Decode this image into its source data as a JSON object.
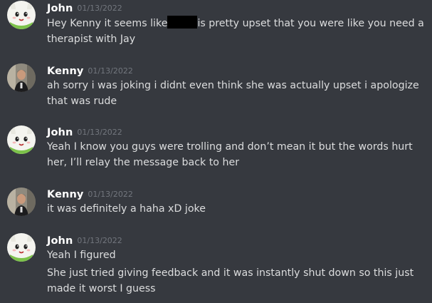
{
  "messages": [
    {
      "author": "John",
      "timestamp": "01/13/2022",
      "avatar_icon": "cat-mascot-avatar",
      "lines": [
        {
          "before": "Hey Kenny it seems like",
          "after": "is pretty upset that you were like you need a"
        },
        "therapist with Jay"
      ]
    },
    {
      "author": "Kenny",
      "timestamp": "01/13/2022",
      "avatar_icon": "person-photo-avatar",
      "lines": [
        "ah sorry i was joking i didnt even think she was actually upset i apologize",
        "that was rude"
      ]
    },
    {
      "author": "John",
      "timestamp": "01/13/2022",
      "avatar_icon": "cat-mascot-avatar",
      "lines": [
        "Yeah I know you guys were trolling and don’t mean it but the words hurt",
        "her, I’ll relay the message back to her"
      ]
    },
    {
      "author": "Kenny",
      "timestamp": "01/13/2022",
      "avatar_icon": "person-photo-avatar",
      "lines": [
        "it was definitely a haha xD joke"
      ]
    },
    {
      "author": "John",
      "timestamp": "01/13/2022",
      "avatar_icon": "cat-mascot-avatar",
      "lines": [
        "Yeah I figured"
      ],
      "followup": [
        "She just tried giving feedback and it was instantly shut down so this just",
        "made it worst I guess"
      ]
    }
  ],
  "colors": {
    "background": "#36393f",
    "author": "#ffffff",
    "timestamp": "#72767d",
    "text": "#dcddde",
    "redaction": "#000000"
  }
}
